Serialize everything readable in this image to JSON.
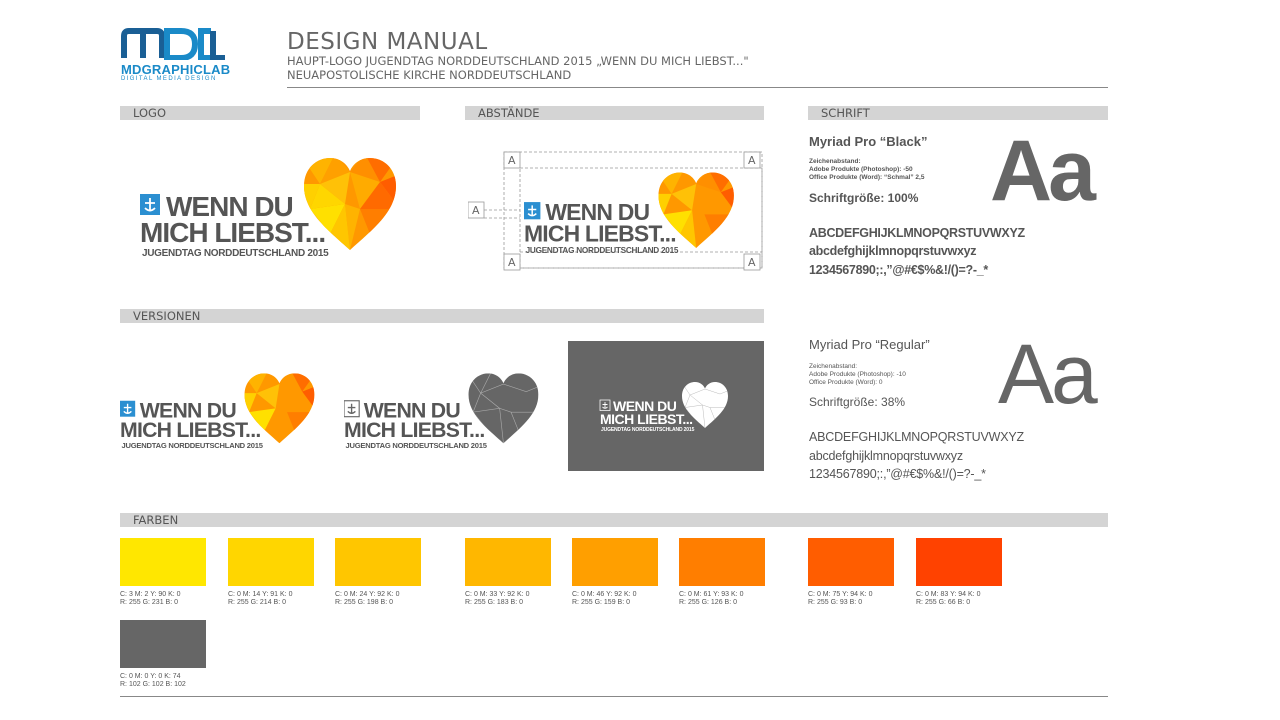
{
  "header": {
    "brand_name": "MDGRAPHICLAB",
    "brand_tagline": "DIGITAL MEDIA DESIGN",
    "brand_color": "#1a8ac8",
    "title": "DESIGN MANUAL",
    "subtitle_1": "HAUPT-LOGO JUGENDTAG NORDDEUTSCHLAND 2015 „WENN DU MICH LIEBST...\"",
    "subtitle_2": "NEUAPOSTOLISCHE KIRCHE NORDDEUTSCHLAND"
  },
  "sections": {
    "logo": "LOGO",
    "abstaende": "ABSTÄNDE",
    "schrift": "SCHRIFT",
    "versionen": "VERSIONEN",
    "farben": "FARBEN"
  },
  "logo": {
    "line1": "WENN DU",
    "line2": "MICH LIEBST...",
    "line3": "JUGENDTAG NORDDEUTSCHLAND 2015",
    "icon": "church-emblem-icon",
    "heart_icon": "low-poly-heart-icon"
  },
  "spacing_marker": "A",
  "fonts": {
    "black": {
      "name": "Myriad Pro “Black”",
      "spacing_title": "Zeichenabstand:",
      "spacing_adobe": "Adobe Produkte (Photoshop): -50",
      "spacing_office": "Office Produkte (Word): “Schmal” 2,5",
      "size": "Schriftgröße: 100%",
      "sample": "Aa",
      "upper": "ABCDEFGHIJKLMNOPQRSTUVWXYZ",
      "lower": "abcdefghijklmnopqrstuvwxyz",
      "digits": "1234567890;:,”@#€$%&!/()=?-_*"
    },
    "regular": {
      "name": "Myriad Pro “Regular”",
      "spacing_title": "Zeichenabstand:",
      "spacing_adobe": "Adobe Produkte (Photoshop): -10",
      "spacing_office": "Office Produkte (Word): 0",
      "size": "Schriftgröße: 38%",
      "sample": "Aa",
      "upper": "ABCDEFGHIJKLMNOPQRSTUVWXYZ",
      "lower": "abcdefghijklmnopqrstuvwxyz",
      "digits": "1234567890;:,”@#€$%&!/()=?-_*"
    }
  },
  "colors": [
    {
      "hex": "#ffe700",
      "cmyk": "C: 3   M: 2   Y: 90   K: 0",
      "rgb": "R: 255   G: 231   B: 0"
    },
    {
      "hex": "#ffd600",
      "cmyk": "C: 0   M: 14   Y: 91   K: 0",
      "rgb": "R: 255   G: 214   B: 0"
    },
    {
      "hex": "#ffc600",
      "cmyk": "C: 0   M: 24   Y: 92   K: 0",
      "rgb": "R: 255   G: 198   B: 0"
    },
    {
      "hex": "#ffb700",
      "cmyk": "C: 0   M: 33   Y: 92   K: 0",
      "rgb": "R: 255   G: 183   B: 0"
    },
    {
      "hex": "#ff9f00",
      "cmyk": "C: 0   M: 46   Y: 92   K: 0",
      "rgb": "R: 255   G: 159   B: 0"
    },
    {
      "hex": "#ff7e00",
      "cmyk": "C: 0   M: 61   Y: 93   K: 0",
      "rgb": "R: 255   G: 126   B: 0"
    },
    {
      "hex": "#ff5d00",
      "cmyk": "C: 0   M: 75   Y: 94   K: 0",
      "rgb": "R: 255   G: 93   B: 0"
    },
    {
      "hex": "#ff4200",
      "cmyk": "C: 0   M: 83   Y: 94   K: 0",
      "rgb": "R: 255   G: 66   B: 0"
    },
    {
      "hex": "#666666",
      "cmyk": "C: 0   M: 0   Y: 0   K: 74",
      "rgb": "R: 102   G: 102   B: 102"
    }
  ]
}
